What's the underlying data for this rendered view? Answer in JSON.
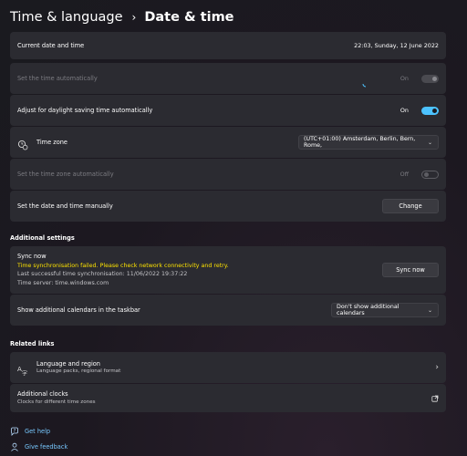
{
  "header": {
    "parent": "Time & language",
    "separator": "›",
    "title": "Date & time"
  },
  "rows": {
    "current": {
      "label": "Current date and time",
      "value": "22:03, Sunday, 12 June 2022"
    },
    "auto_time": {
      "label": "Set the time automatically",
      "state": "On"
    },
    "dst": {
      "label": "Adjust for daylight saving time automatically",
      "state": "On"
    },
    "timezone": {
      "label": "Time zone",
      "value": "(UTC+01:00) Amsterdam, Berlin, Bern, Rome,"
    },
    "auto_zone": {
      "label": "Set the time zone automatically",
      "state": "Off"
    },
    "manual": {
      "label": "Set the date and time manually",
      "button": "Change"
    }
  },
  "additional": {
    "heading": "Additional settings",
    "sync": {
      "title": "Sync now",
      "error": "Time synchronisation failed. Please check network connectivity and retry.",
      "last": "Last successful time synchronisation: 11/06/2022 19:37:22",
      "server": "Time server: time.windows.com",
      "button": "Sync now"
    },
    "calendars": {
      "label": "Show additional calendars in the taskbar",
      "value": "Don't show additional calendars"
    }
  },
  "related": {
    "heading": "Related links",
    "region": {
      "title": "Language and region",
      "subtitle": "Language packs, regional format"
    },
    "clocks": {
      "title": "Additional clocks",
      "subtitle": "Clocks for different time zones"
    }
  },
  "footer": {
    "help": "Get help",
    "feedback": "Give feedback"
  },
  "colors": {
    "accent": "#4cc2ff",
    "warning": "#fce100",
    "link": "#78c8ff",
    "card": "#2b2b31"
  }
}
